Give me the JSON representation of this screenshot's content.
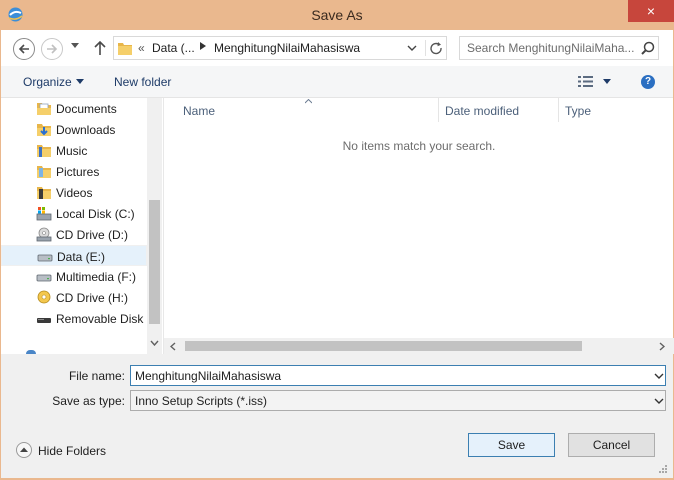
{
  "window": {
    "title": "Save As",
    "close_glyph": "×"
  },
  "address": {
    "crumbs_overflow": "«",
    "crumb_1": "Data (...",
    "crumb_2": "MenghitungNilaiMahasiswa"
  },
  "search": {
    "placeholder": "Search MenghitungNilaiMaha..."
  },
  "toolbar": {
    "organize_label": "Organize",
    "new_folder_label": "New folder",
    "help_glyph": "?"
  },
  "nav_pane": {
    "items": [
      {
        "label": "Documents",
        "icon": "documents-icon"
      },
      {
        "label": "Downloads",
        "icon": "downloads-icon"
      },
      {
        "label": "Music",
        "icon": "music-icon"
      },
      {
        "label": "Pictures",
        "icon": "pictures-icon"
      },
      {
        "label": "Videos",
        "icon": "videos-icon"
      },
      {
        "label": "Local Disk (C:)",
        "icon": "local-disk-icon"
      },
      {
        "label": "CD Drive (D:)",
        "icon": "cd-drive-icon"
      },
      {
        "label": "Data (E:)",
        "icon": "drive-icon",
        "selected": true
      },
      {
        "label": "Multimedia (F:)",
        "icon": "drive-icon"
      },
      {
        "label": "CD Drive (H:)",
        "icon": "cd-drive-gold-icon"
      },
      {
        "label": "Removable Disk (",
        "icon": "removable-disk-icon"
      }
    ]
  },
  "file_list": {
    "columns": [
      "Name",
      "Date modified",
      "Type"
    ],
    "empty_message": "No items match your search."
  },
  "form": {
    "file_name_label": "File name:",
    "file_name_value": "MenghitungNilaiMahasiswa",
    "save_type_label": "Save as type:",
    "save_type_value": "Inno Setup Scripts (*.iss)",
    "hide_folders_label": "Hide Folders",
    "save_label": "Save",
    "cancel_label": "Cancel"
  },
  "colors": {
    "titlebar": "#eab88e",
    "close": "#c7463c",
    "accent": "#3c7fb1",
    "selection": "#e5f1fb"
  }
}
